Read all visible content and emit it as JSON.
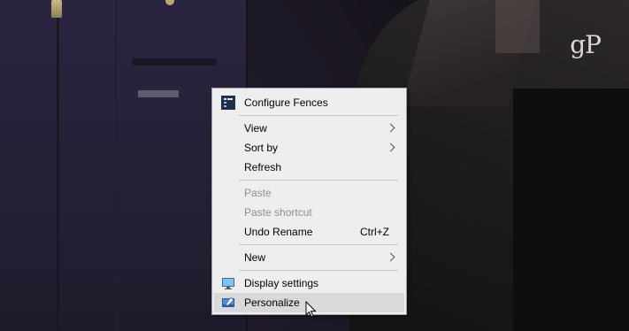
{
  "watermark": "gP",
  "menu": {
    "configure_fences": "Configure Fences",
    "view": "View",
    "sort_by": "Sort by",
    "refresh": "Refresh",
    "paste": "Paste",
    "paste_shortcut": "Paste shortcut",
    "undo_rename": "Undo Rename",
    "undo_rename_shortcut": "Ctrl+Z",
    "new": "New",
    "display_settings": "Display settings",
    "personalize": "Personalize"
  },
  "icons": {
    "configure_fences": "fences-icon",
    "display_settings": "monitor-icon",
    "personalize": "personalize-icon",
    "submenu": "chevron-right-icon",
    "cursor": "mouse-pointer-icon"
  },
  "colors": {
    "menu_background": "#eeeeee",
    "menu_hover": "#d9d9d9",
    "menu_disabled_text": "#8f8f8f"
  }
}
